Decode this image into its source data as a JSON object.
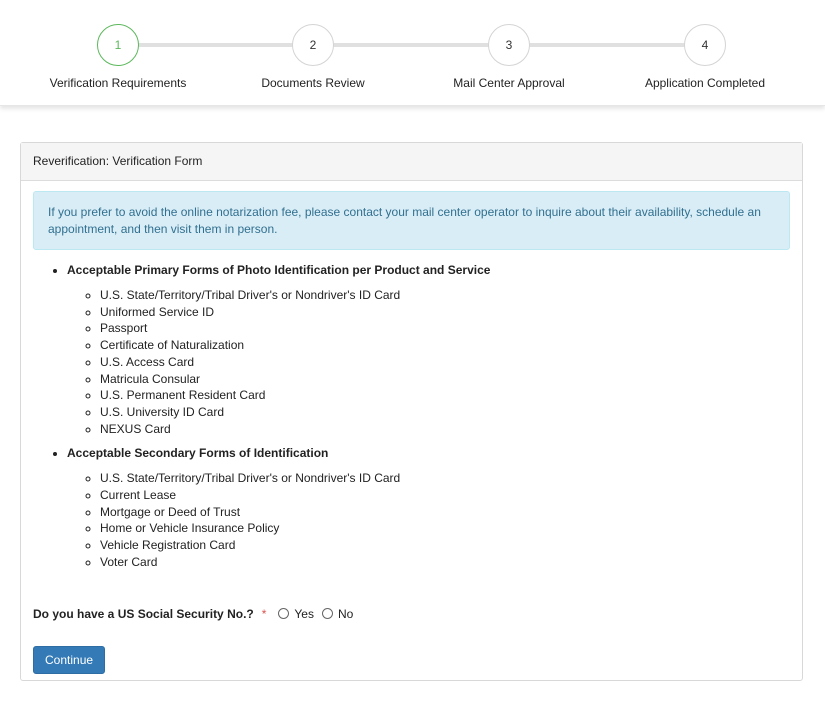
{
  "stepper": {
    "steps": [
      {
        "number": "1",
        "label": "Verification Requirements",
        "active": true
      },
      {
        "number": "2",
        "label": "Documents Review",
        "active": false
      },
      {
        "number": "3",
        "label": "Mail Center Approval",
        "active": false
      },
      {
        "number": "4",
        "label": "Application Completed",
        "active": false
      }
    ],
    "active_color": "#5cb85c"
  },
  "panel": {
    "title": "Reverification: Verification Form",
    "alert": "If you prefer to avoid the online notarization fee, please contact your mail center operator to inquire about their availability, schedule an appointment, and then visit them in person.",
    "sections": [
      {
        "heading": "Acceptable Primary Forms of Photo Identification per Product and Service",
        "items": [
          "U.S. State/Territory/Tribal Driver's or Nondriver's ID Card",
          "Uniformed Service ID",
          "Passport",
          "Certificate of Naturalization",
          "U.S. Access Card",
          "Matricula Consular",
          "U.S. Permanent Resident Card",
          "U.S. University ID Card",
          "NEXUS Card"
        ]
      },
      {
        "heading": "Acceptable Secondary Forms of Identification",
        "items": [
          "U.S. State/Territory/Tribal Driver's or Nondriver's ID Card",
          "Current Lease",
          "Mortgage or Deed of Trust",
          "Home or Vehicle Insurance Policy",
          "Vehicle Registration Card",
          "Voter Card"
        ]
      }
    ],
    "question": {
      "label": "Do you have a US Social Security No.?",
      "required_mark": "*",
      "options": [
        "Yes",
        "No"
      ]
    },
    "continue_label": "Continue"
  },
  "colors": {
    "primary_button": "#337ab7",
    "alert_bg": "#d9edf7",
    "alert_text": "#31708f",
    "required": "#d9534f"
  }
}
